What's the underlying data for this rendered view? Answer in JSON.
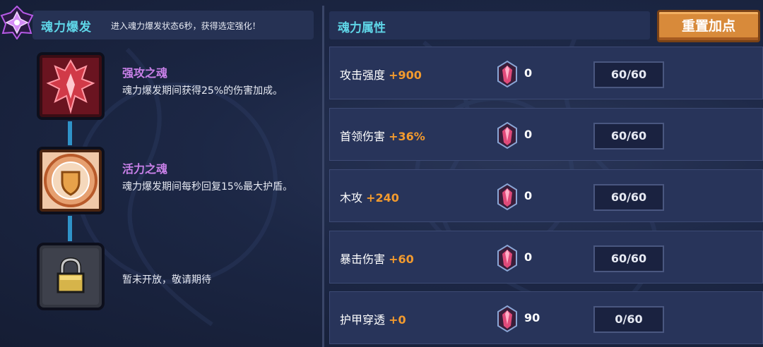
{
  "burst": {
    "title": "魂力爆发",
    "description": "进入魂力爆发状态6秒，获得选定强化！"
  },
  "skills": [
    {
      "name": "强攻之魂",
      "description": "魂力爆发期间获得25%的伤害加成。",
      "icon": "red-attack-soul-icon"
    },
    {
      "name": "活力之魂",
      "description": "魂力爆发期间每秒回复15%最大护盾。",
      "icon": "shield-soul-icon"
    },
    {
      "name": "",
      "description": "暂未开放，敬请期待",
      "icon": "lock-icon"
    }
  ],
  "attributes": {
    "title": "魂力属性",
    "reset_label": "重置加点",
    "rows": [
      {
        "name": "攻击强度",
        "bonus": "+900",
        "points": "0",
        "level": "60/60"
      },
      {
        "name": "首领伤害",
        "bonus": "+36%",
        "points": "0",
        "level": "60/60"
      },
      {
        "name": "木攻",
        "bonus": "+240",
        "points": "0",
        "level": "60/60"
      },
      {
        "name": "暴击伤害",
        "bonus": "+60",
        "points": "0",
        "level": "60/60"
      },
      {
        "name": "护甲穿透",
        "bonus": "+0",
        "points": "90",
        "level": "0/60"
      }
    ]
  },
  "colors": {
    "accent_cyan": "#5fd6e8",
    "skill_purple": "#c880e8",
    "bonus_orange": "#f29a2e",
    "reset_button": "#d88a3a"
  }
}
